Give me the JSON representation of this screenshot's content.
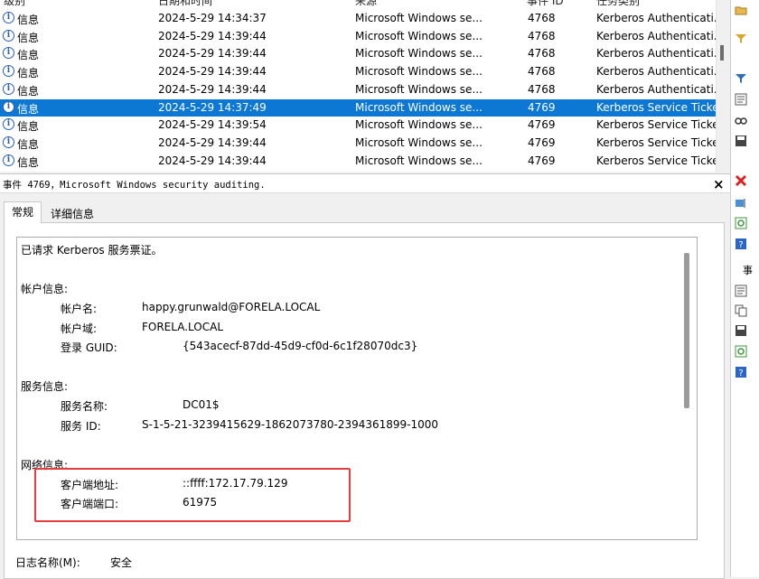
{
  "list": {
    "headers": {
      "level": "级别",
      "datetime": "日期和时间",
      "source": "来源",
      "event_id": "事件 ID",
      "category": "任务类别"
    },
    "rows": [
      {
        "level": "信息",
        "datetime": "2024-5-29 14:34:37",
        "source": "Microsoft Windows se...",
        "event_id": "4768",
        "category": "Kerberos Authenticati..."
      },
      {
        "level": "信息",
        "datetime": "2024-5-29 14:39:44",
        "source": "Microsoft Windows se...",
        "event_id": "4768",
        "category": "Kerberos Authenticati..."
      },
      {
        "level": "信息",
        "datetime": "2024-5-29 14:39:44",
        "source": "Microsoft Windows se...",
        "event_id": "4768",
        "category": "Kerberos Authenticati..."
      },
      {
        "level": "信息",
        "datetime": "2024-5-29 14:39:44",
        "source": "Microsoft Windows se...",
        "event_id": "4768",
        "category": "Kerberos Authenticati..."
      },
      {
        "level": "信息",
        "datetime": "2024-5-29 14:39:44",
        "source": "Microsoft Windows se...",
        "event_id": "4768",
        "category": "Kerberos Authenticati..."
      },
      {
        "level": "信息",
        "datetime": "2024-5-29 14:37:49",
        "source": "Microsoft Windows se...",
        "event_id": "4769",
        "category": "Kerberos Service Ticke...",
        "selected": true
      },
      {
        "level": "信息",
        "datetime": "2024-5-29 14:39:54",
        "source": "Microsoft Windows se...",
        "event_id": "4769",
        "category": "Kerberos Service Ticke..."
      },
      {
        "level": "信息",
        "datetime": "2024-5-29 14:39:44",
        "source": "Microsoft Windows se...",
        "event_id": "4769",
        "category": "Kerberos Service Ticke..."
      },
      {
        "level": "信息",
        "datetime": "2024-5-29 14:39:44",
        "source": "Microsoft Windows se...",
        "event_id": "4769",
        "category": "Kerberos Service Ticke..."
      }
    ]
  },
  "detail": {
    "title": "事件 4769，Microsoft Windows security auditing.",
    "close": "×",
    "tabs": {
      "general": "常规",
      "details": "详细信息"
    },
    "summary": "已请求 Kerberos 服务票证。",
    "account_section": "帐户信息:",
    "account_name_label": "帐户名:",
    "account_name": "happy.grunwald@FORELA.LOCAL",
    "account_domain_label": "帐户域:",
    "account_domain": "FORELA.LOCAL",
    "logon_guid_label": "登录 GUID:",
    "logon_guid": "{543acecf-87dd-45d9-cf0d-6c1f28070dc3}",
    "service_section": "服务信息:",
    "service_name_label": "服务名称:",
    "service_name": "DC01$",
    "service_id_label": "服务 ID:",
    "service_id": "S-1-5-21-3239415629-1862073780-2394361899-1000",
    "network_section": "网络信息:",
    "client_addr_label": "客户端地址:",
    "client_addr": "::ffff:172.17.79.129",
    "client_port_label": "客户端端口:",
    "client_port": "61975",
    "log_name_label": "日志名称(M):",
    "log_name": "安全"
  },
  "colors": {
    "selection": "#0c78d3",
    "highlight_box": "#e53d3d"
  }
}
